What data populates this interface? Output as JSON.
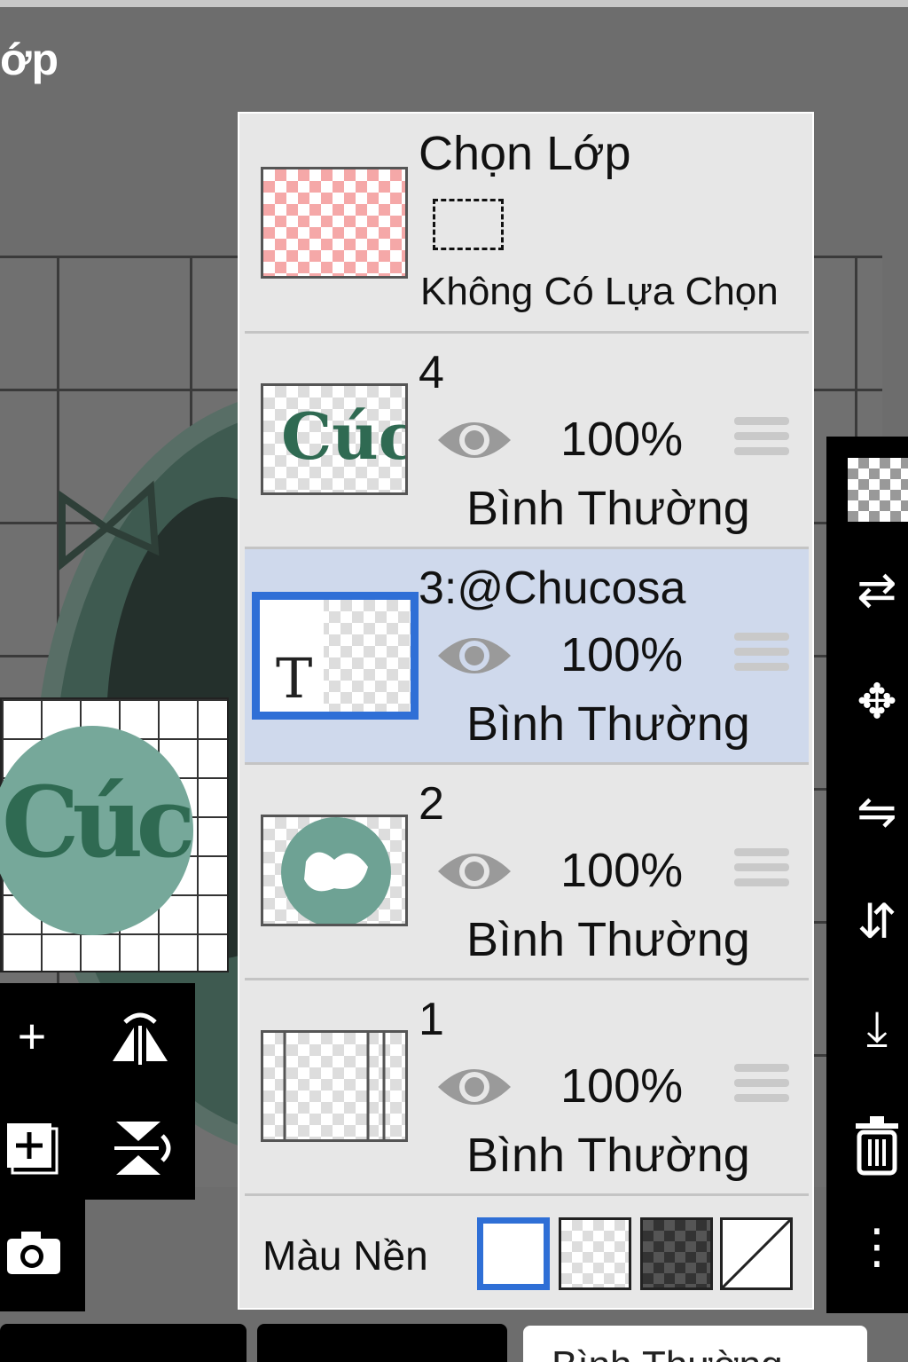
{
  "app": {
    "title_fragment": "ớp"
  },
  "layer_panel": {
    "selection": {
      "title": "Chọn Lớp",
      "status": "Không Có Lựa Chọn"
    },
    "layers": [
      {
        "name": "4",
        "opacity": "100%",
        "blend": "Bình Thường",
        "selected": false
      },
      {
        "name": "3:@Chucosa",
        "opacity": "100%",
        "blend": "Bình Thường",
        "selected": true,
        "thumb_glyph": "T"
      },
      {
        "name": "2",
        "opacity": "100%",
        "blend": "Bình Thường",
        "selected": false
      },
      {
        "name": "1",
        "opacity": "100%",
        "blend": "Bình Thường",
        "selected": false
      }
    ],
    "background": {
      "label": "Màu Nền",
      "options": [
        "white",
        "transparent",
        "dark-checker",
        "none"
      ],
      "selected": "white"
    }
  },
  "preview": {
    "art_text": "Cúc"
  },
  "left_tools": [
    {
      "icon": "add-layer-icon",
      "glyph": "+"
    },
    {
      "icon": "flip-horizontal-icon",
      "glyph": "⇋"
    },
    {
      "icon": "add-copy-layer-icon",
      "glyph": "+"
    },
    {
      "icon": "flip-vertical-icon",
      "glyph": "⇵"
    },
    {
      "icon": "camera-icon",
      "glyph": "📷"
    }
  ],
  "right_tools": [
    {
      "icon": "transparency-icon"
    },
    {
      "icon": "swap-layer-icon",
      "glyph": "⇄"
    },
    {
      "icon": "move-icon",
      "glyph": "✥"
    },
    {
      "icon": "rotate-flip-icon",
      "glyph": "⇋"
    },
    {
      "icon": "vertical-flip-icon",
      "glyph": "⇵"
    },
    {
      "icon": "merge-down-icon",
      "glyph": "⤓"
    },
    {
      "icon": "trash-icon",
      "glyph": "🗑"
    },
    {
      "icon": "more-icon",
      "glyph": "⋮"
    }
  ],
  "bottom_bar": {
    "mode_label": "Bình Thường"
  },
  "colors": {
    "accent": "#2f6fd6",
    "selected_row": "#cfd9ec",
    "panel_bg": "#e7e7e7",
    "art_green": "#2f6a52"
  }
}
